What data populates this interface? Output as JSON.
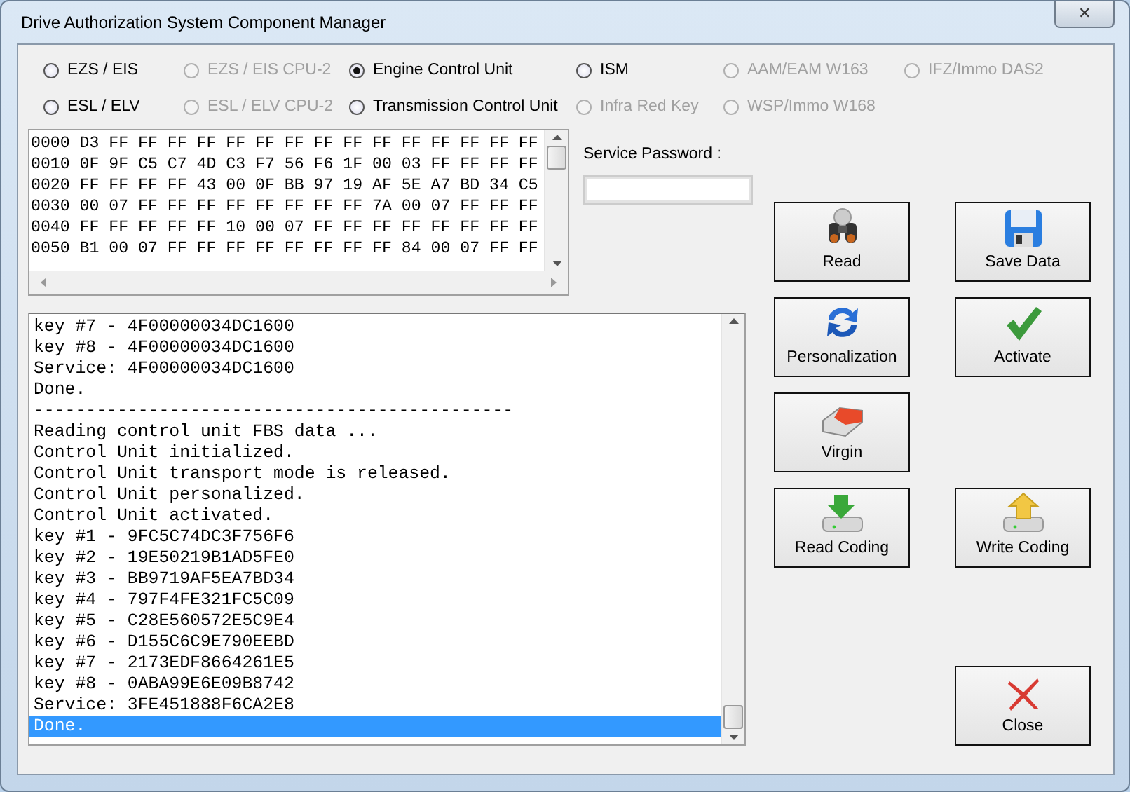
{
  "window": {
    "title": "Drive Authorization System Component Manager",
    "close": "✕"
  },
  "units": [
    {
      "label": "EZS / EIS",
      "checked": false,
      "disabled": false
    },
    {
      "label": "EZS / EIS CPU-2",
      "checked": false,
      "disabled": true
    },
    {
      "label": "Engine Control Unit",
      "checked": true,
      "disabled": false
    },
    {
      "label": "ISM",
      "checked": false,
      "disabled": false
    },
    {
      "label": "AAM/EAM W163",
      "checked": false,
      "disabled": true
    },
    {
      "label": "IFZ/Immo DAS2",
      "checked": false,
      "disabled": true
    },
    {
      "label": "ESL / ELV",
      "checked": false,
      "disabled": false
    },
    {
      "label": "ESL / ELV CPU-2",
      "checked": false,
      "disabled": true
    },
    {
      "label": "Transmission Control Unit",
      "checked": false,
      "disabled": false
    },
    {
      "label": "Infra Red Key",
      "checked": false,
      "disabled": true
    },
    {
      "label": "WSP/Immo W168",
      "checked": false,
      "disabled": true
    }
  ],
  "hex_rows": [
    "0000 D3 FF FF FF FF FF FF FF FF FF FF FF FF FF FF FF",
    "0010 0F 9F C5 C7 4D C3 F7 56 F6 1F 00 03 FF FF FF FF",
    "0020 FF FF FF FF 43 00 0F BB 97 19 AF 5E A7 BD 34 C5",
    "0030 00 07 FF FF FF FF FF FF FF FF 7A 00 07 FF FF FF",
    "0040 FF FF FF FF FF 10 00 07 FF FF FF FF FF FF FF FF",
    "0050 B1 00 07 FF FF FF FF FF FF FF FF 84 00 07 FF FF"
  ],
  "service_password": {
    "label": "Service Password :"
  },
  "log": [
    {
      "text": "key #7 - 4F00000034DC1600",
      "selected": false
    },
    {
      "text": "key #8 - 4F00000034DC1600",
      "selected": false
    },
    {
      "text": "Service: 4F00000034DC1600",
      "selected": false
    },
    {
      "text": "Done.",
      "selected": false
    },
    {
      "text": "----------------------------------------------",
      "selected": false
    },
    {
      "text": "Reading control unit FBS data ...",
      "selected": false
    },
    {
      "text": "Control Unit initialized.",
      "selected": false
    },
    {
      "text": "Control Unit transport mode is released.",
      "selected": false
    },
    {
      "text": "Control Unit personalized.",
      "selected": false
    },
    {
      "text": "Control Unit activated.",
      "selected": false
    },
    {
      "text": "key #1 - 9FC5C74DC3F756F6",
      "selected": false
    },
    {
      "text": "key #2 - 19E50219B1AD5FE0",
      "selected": false
    },
    {
      "text": "key #3 - BB9719AF5EA7BD34",
      "selected": false
    },
    {
      "text": "key #4 - 797F4FE321FC5C09",
      "selected": false
    },
    {
      "text": "key #5 - C28E560572E5C9E4",
      "selected": false
    },
    {
      "text": "key #6 - D155C6C9E790EEBD",
      "selected": false
    },
    {
      "text": "key #7 - 2173EDF8664261E5",
      "selected": false
    },
    {
      "text": "key #8 - 0ABA99E6E09B8742",
      "selected": false
    },
    {
      "text": "Service: 3FE451888F6CA2E8",
      "selected": false
    },
    {
      "text": "Done.",
      "selected": true
    }
  ],
  "buttons": [
    "Read",
    "Save Data",
    "Personalization",
    "Activate",
    "Virgin",
    "Read Coding",
    "Write Coding"
  ],
  "close_button": "Close"
}
